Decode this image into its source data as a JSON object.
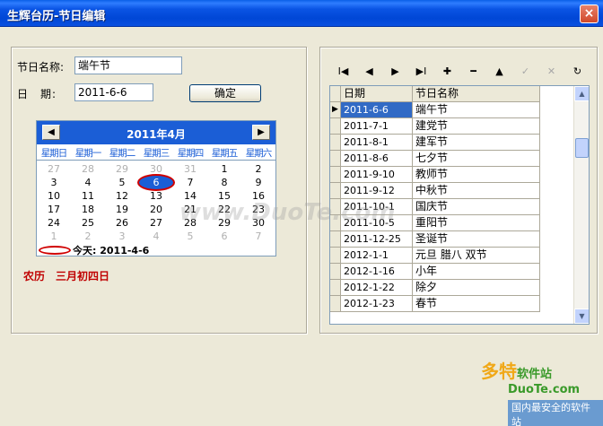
{
  "window": {
    "title": "生辉台历-节日编辑",
    "close_glyph": "×"
  },
  "form": {
    "name_label": "节日名称:",
    "name_value": "端午节",
    "date_label": "日　期:",
    "date_value": "2011-6-6",
    "confirm_label": "确定"
  },
  "calendar": {
    "prev_glyph": "◀",
    "next_glyph": "▶",
    "month_title": "2011年4月",
    "weekdays": [
      "星期日",
      "星期一",
      "星期二",
      "星期三",
      "星期四",
      "星期五",
      "星期六"
    ],
    "weeks": [
      [
        "27",
        "28",
        "29",
        "30",
        "31",
        "1",
        "2"
      ],
      [
        "3",
        "4",
        "5",
        "6",
        "7",
        "8",
        "9"
      ],
      [
        "10",
        "11",
        "12",
        "13",
        "14",
        "15",
        "16"
      ],
      [
        "17",
        "18",
        "19",
        "20",
        "21",
        "22",
        "23"
      ],
      [
        "24",
        "25",
        "26",
        "27",
        "28",
        "29",
        "30"
      ],
      [
        "1",
        "2",
        "3",
        "4",
        "5",
        "6",
        "7"
      ]
    ],
    "today_label": "今天: 2011-4-6"
  },
  "lunar_text": "农历　三月初四日",
  "toolbar": {
    "first": "I◀",
    "prev": "◀",
    "next": "▶",
    "last": "▶I",
    "insert": "✚",
    "delete": "━",
    "edit": "▲",
    "post": "✓",
    "cancel": "✕",
    "refresh": "↻"
  },
  "grid": {
    "columns": [
      "日期",
      "节日名称"
    ],
    "current_indicator": "▶",
    "rows": [
      {
        "date": "2011-6-6",
        "name": "端午节"
      },
      {
        "date": "2011-7-1",
        "name": "建党节"
      },
      {
        "date": "2011-8-1",
        "name": "建军节"
      },
      {
        "date": "2011-8-6",
        "name": "七夕节"
      },
      {
        "date": "2011-9-10",
        "name": "教师节"
      },
      {
        "date": "2011-9-12",
        "name": "中秋节"
      },
      {
        "date": "2011-10-1",
        "name": "国庆节"
      },
      {
        "date": "2011-10-5",
        "name": "重阳节"
      },
      {
        "date": "2011-12-25",
        "name": "圣诞节"
      },
      {
        "date": "2012-1-1",
        "name": "元旦 腊八 双节"
      },
      {
        "date": "2012-1-16",
        "name": "小年"
      },
      {
        "date": "2012-1-22",
        "name": "除夕"
      },
      {
        "date": "2012-1-23",
        "name": "春节"
      }
    ]
  },
  "watermark": {
    "center": "www.DuoTe.com",
    "logo_text": "多特",
    "logo_sub": "软件站",
    "logo_url": "DuoTe.com",
    "logo_slogan": "国内最安全的软件站"
  }
}
